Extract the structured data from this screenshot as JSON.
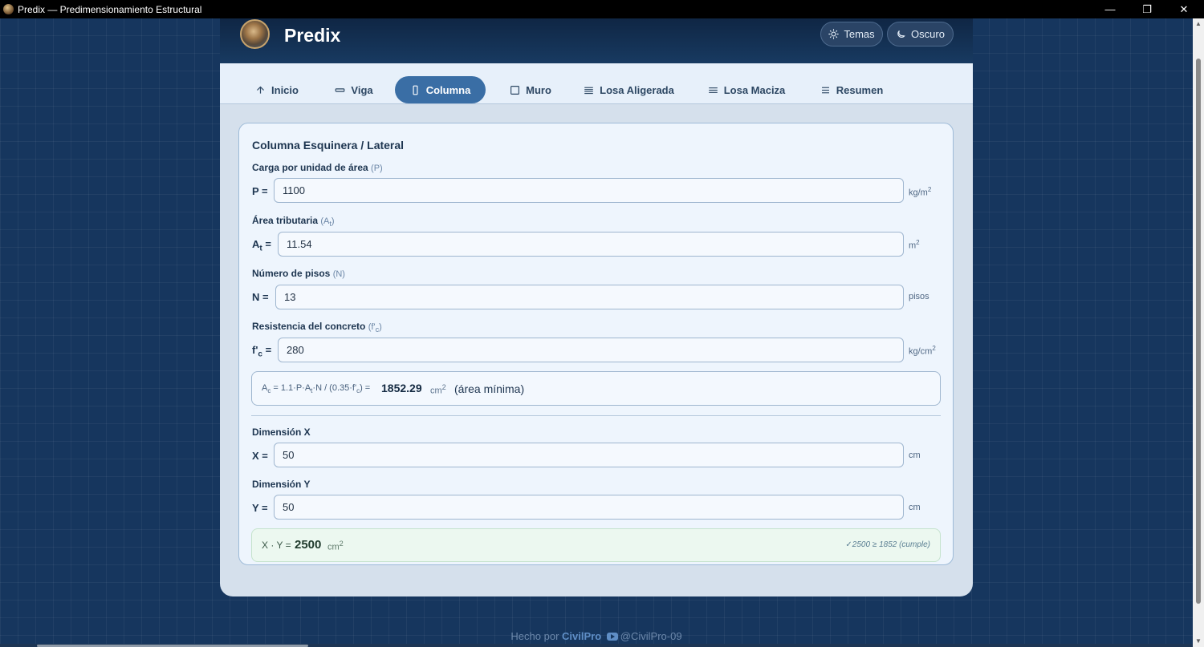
{
  "window": {
    "title": "Predix — Predimensionamiento Estructural",
    "minimize": "—",
    "maximize": "❐",
    "close": "✕"
  },
  "header": {
    "brand": "Predix",
    "themes_label": "Temas",
    "dark_label": "Oscuro"
  },
  "tabs": [
    {
      "label": "Inicio",
      "icon": "home-icon"
    },
    {
      "label": "Viga",
      "icon": "beam-icon"
    },
    {
      "label": "Columna",
      "icon": "column-icon",
      "active": true
    },
    {
      "label": "Muro",
      "icon": "wall-icon"
    },
    {
      "label": "Losa Aligerada",
      "icon": "slab-icon"
    },
    {
      "label": "Losa Maciza",
      "icon": "solid-slab-icon"
    },
    {
      "label": "Resumen",
      "icon": "summary-icon"
    }
  ],
  "panel": {
    "title": "Columna Esquinera / Lateral",
    "fields": {
      "p": {
        "label": "Carga por unidad de área",
        "hint": "(P)",
        "symbol": "P =",
        "value": "1100",
        "unit": "kg/m",
        "unit_sup": "2"
      },
      "at": {
        "label": "Área tributaria",
        "hint_main": "(A",
        "hint_sub": "t",
        "hint_end": ")",
        "symbol_main": "A",
        "symbol_sub": "t",
        "symbol_end": " =",
        "value": "11.54",
        "unit": "m",
        "unit_sup": "2"
      },
      "n": {
        "label": "Número de pisos",
        "hint": "(N)",
        "symbol": "N =",
        "value": "13",
        "unit": "pisos"
      },
      "fc": {
        "label": "Resistencia del concreto",
        "hint_main": "(f'",
        "hint_sub": "c",
        "hint_end": ")",
        "symbol_main": "f'",
        "symbol_sub": "c",
        "symbol_end": " =",
        "value": "280",
        "unit": "kg/cm",
        "unit_sup": "2"
      }
    },
    "formula": {
      "a": "A",
      "a_sub": "c",
      "mid": " = 1.1·P·A",
      "mid_sub": "t",
      "rest": "·N / (0.35·f'",
      "rest_sub": "c",
      "end": ") =",
      "value": "1852.29",
      "unit": "cm",
      "unit_sup": "2",
      "note": "(área mínima)"
    },
    "dim_x": {
      "label": "Dimensión X",
      "symbol": "X =",
      "value": "50",
      "unit": "cm"
    },
    "dim_y": {
      "label": "Dimensión Y",
      "symbol": "Y =",
      "value": "50",
      "unit": "cm"
    },
    "result": {
      "label": "X · Y =",
      "value": "2500",
      "unit": "cm",
      "unit_sup": "2",
      "check": "✓2500 ≥ 1852 (cumple)"
    }
  },
  "footer": {
    "made_by": "Hecho por",
    "author": "CivilPro",
    "channel": "@CivilPro-09"
  },
  "colors": {
    "accent": "#3a6ea5",
    "background": "#16365e",
    "success_bg": "#ecf8f0"
  }
}
